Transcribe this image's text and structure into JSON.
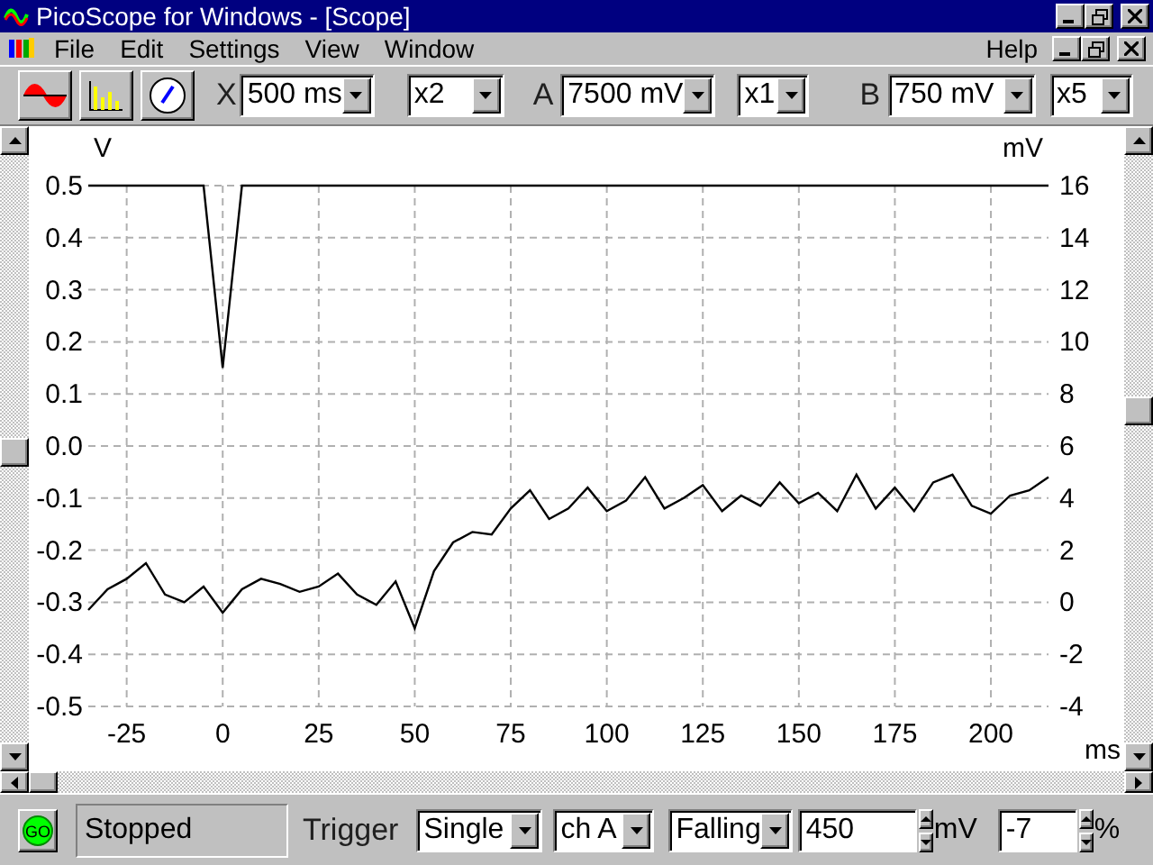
{
  "window": {
    "title": "PicoScope for Windows - [Scope]"
  },
  "menu": [
    {
      "label": "File"
    },
    {
      "label": "Edit"
    },
    {
      "label": "Settings"
    },
    {
      "label": "View"
    },
    {
      "label": "Window"
    }
  ],
  "help_menu": "Help",
  "toolbar": {
    "x_label": "X",
    "timebase": "500 ms",
    "x_zoom": "x2",
    "a_label": "A",
    "a_range": "7500 mV",
    "a_zoom": "x1",
    "b_label": "B",
    "b_range": "750 mV",
    "b_zoom": "x5"
  },
  "scope": {
    "chart_data": {
      "type": "line",
      "grid": true,
      "xlabel": "ms",
      "ylabel": "V",
      "y2label": "mV",
      "xlim": [
        -35,
        215
      ],
      "ylim": [
        -0.5,
        0.5
      ],
      "y2lim": [
        -4,
        16
      ],
      "xticks": [
        -25,
        0,
        25,
        50,
        75,
        100,
        125,
        150,
        175,
        200
      ],
      "yticks": [
        {
          "value": 0.5,
          "label": "0.5"
        },
        {
          "value": 0.4,
          "label": "0.4"
        },
        {
          "value": 0.3,
          "label": "0.3"
        },
        {
          "value": 0.2,
          "label": "0.2"
        },
        {
          "value": 0.1,
          "label": "0.1"
        },
        {
          "value": 0,
          "label": "0.0"
        },
        {
          "value": -0.1,
          "label": "-0.1"
        },
        {
          "value": -0.2,
          "label": "-0.2"
        },
        {
          "value": -0.3,
          "label": "-0.3"
        },
        {
          "value": -0.4,
          "label": "-0.4"
        },
        {
          "value": -0.5,
          "label": "-0.5"
        }
      ],
      "y2ticks": [
        16,
        14,
        12,
        10,
        8,
        6,
        4,
        2,
        0,
        -2,
        -4
      ],
      "x": [
        -35,
        -30,
        -25,
        -20,
        -15,
        -10,
        -5,
        0,
        5,
        10,
        15,
        20,
        25,
        30,
        35,
        40,
        45,
        50,
        55,
        60,
        65,
        70,
        75,
        80,
        85,
        90,
        95,
        100,
        105,
        110,
        115,
        120,
        125,
        130,
        135,
        140,
        145,
        150,
        155,
        160,
        165,
        170,
        175,
        180,
        185,
        190,
        195,
        200,
        205,
        210,
        215
      ],
      "series": [
        {
          "color": "#000000",
          "values": [
            0.5,
            0.5,
            0.5,
            0.5,
            0.5,
            0.5,
            0.5,
            0.15,
            0.5,
            0.5,
            0.5,
            0.5,
            0.5,
            0.5,
            0.5,
            0.5,
            0.5,
            0.5,
            0.5,
            0.5,
            0.5,
            0.5,
            0.5,
            0.5,
            0.5,
            0.5,
            0.5,
            0.5,
            0.5,
            0.5,
            0.5,
            0.5,
            0.5,
            0.5,
            0.5,
            0.5,
            0.5,
            0.5,
            0.5,
            0.5,
            0.5,
            0.5,
            0.5,
            0.5,
            0.5,
            0.5,
            0.5,
            0.5,
            0.5,
            0.5,
            0.5
          ]
        },
        {
          "axis": "y2",
          "color": "#000000",
          "values": [
            -0.3,
            0.5,
            0.9,
            1.5,
            0.3,
            0.0,
            0.6,
            -0.4,
            0.5,
            0.9,
            0.7,
            0.4,
            0.6,
            1.1,
            0.3,
            -0.1,
            0.8,
            -1.0,
            1.2,
            2.3,
            2.7,
            2.6,
            3.6,
            4.3,
            3.2,
            3.6,
            4.4,
            3.5,
            3.9,
            4.8,
            3.6,
            4.0,
            4.5,
            3.5,
            4.1,
            3.7,
            4.6,
            3.8,
            4.2,
            3.5,
            4.9,
            3.6,
            4.4,
            3.5,
            4.6,
            4.9,
            3.7,
            3.4,
            4.1,
            4.3,
            4.8
          ]
        }
      ]
    }
  },
  "status": {
    "go": "GO",
    "state": "Stopped",
    "trigger_label": "Trigger",
    "mode": "Single",
    "channel": "ch A",
    "direction": "Falling",
    "threshold": "450",
    "threshold_unit": "mV",
    "delay": "-7",
    "delay_unit": "%"
  }
}
